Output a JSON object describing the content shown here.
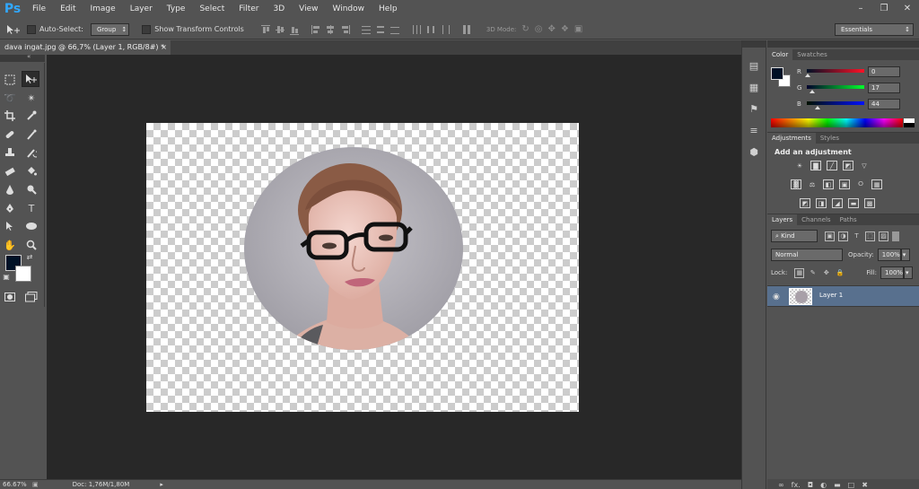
{
  "app": {
    "logo": "Ps"
  },
  "menu": [
    "File",
    "Edit",
    "Image",
    "Layer",
    "Type",
    "Select",
    "Filter",
    "3D",
    "View",
    "Window",
    "Help"
  ],
  "window_controls": {
    "minimize": "–",
    "restore": "❐",
    "close": "✕"
  },
  "options": {
    "auto_select_label": "Auto-Select:",
    "auto_select_target": "Group",
    "show_transform_label": "Show Transform Controls",
    "mode_3d_label": "3D Mode:",
    "workspace": "Essentials"
  },
  "document": {
    "tab_title": "dava ingat.jpg @ 66,7% (Layer 1, RGB/8#) *",
    "close": "×"
  },
  "colors": {
    "foreground": "#001126",
    "background": "#ffffff",
    "layer_highlight": "#58708e"
  },
  "color_panel": {
    "tabs": [
      "Color",
      "Swatches"
    ],
    "r_label": "R",
    "r_value": "0",
    "g_label": "G",
    "g_value": "17",
    "b_label": "B",
    "b_value": "44"
  },
  "adjustments_panel": {
    "tabs": [
      "Adjustments",
      "Styles"
    ],
    "title": "Add an adjustment"
  },
  "layers_panel": {
    "tabs": [
      "Layers",
      "Channels",
      "Paths"
    ],
    "filter_kind": "Kind",
    "blend_mode": "Normal",
    "opacity_label": "Opacity:",
    "opacity_value": "100%",
    "lock_label": "Lock:",
    "fill_label": "Fill:",
    "fill_value": "100%",
    "layers": [
      {
        "name": "Layer 1",
        "visible": true,
        "selected": true
      }
    ],
    "footer_fx": "fx."
  },
  "statusbar": {
    "zoom": "66.67%",
    "doc_info": "Doc: 1,76M/1,80M"
  }
}
